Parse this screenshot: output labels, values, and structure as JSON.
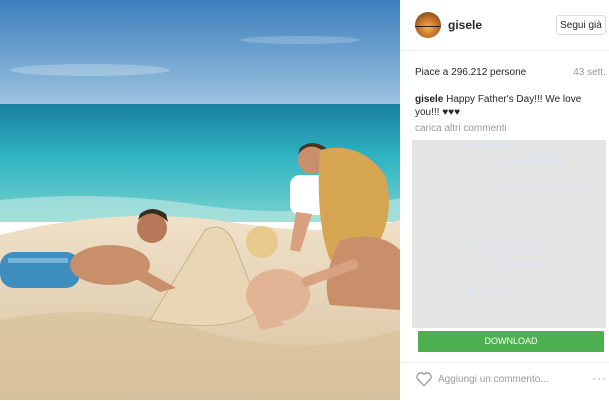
{
  "post": {
    "username": "gisele",
    "follow_label": "Segui già",
    "likes_text": "Piace a 296.212 persone",
    "time_ago": "43 sett.",
    "caption_user": "gisele",
    "caption_text": "Happy Father's Day!!! We love you!!! ♥♥♥",
    "load_more_comments": "carica altri commenti"
  },
  "actions": {
    "download_label": "DOWNLOAD",
    "comment_placeholder": "Aggiungi un commento...",
    "more_label": "···",
    "like_icon": "heart-outline-icon"
  },
  "colors": {
    "download_bg": "#4caf50",
    "overlay_gray": "#e4e4e4",
    "muted_text": "#999999",
    "sea": "#2fb4c2",
    "sky": "#4f92c6"
  }
}
